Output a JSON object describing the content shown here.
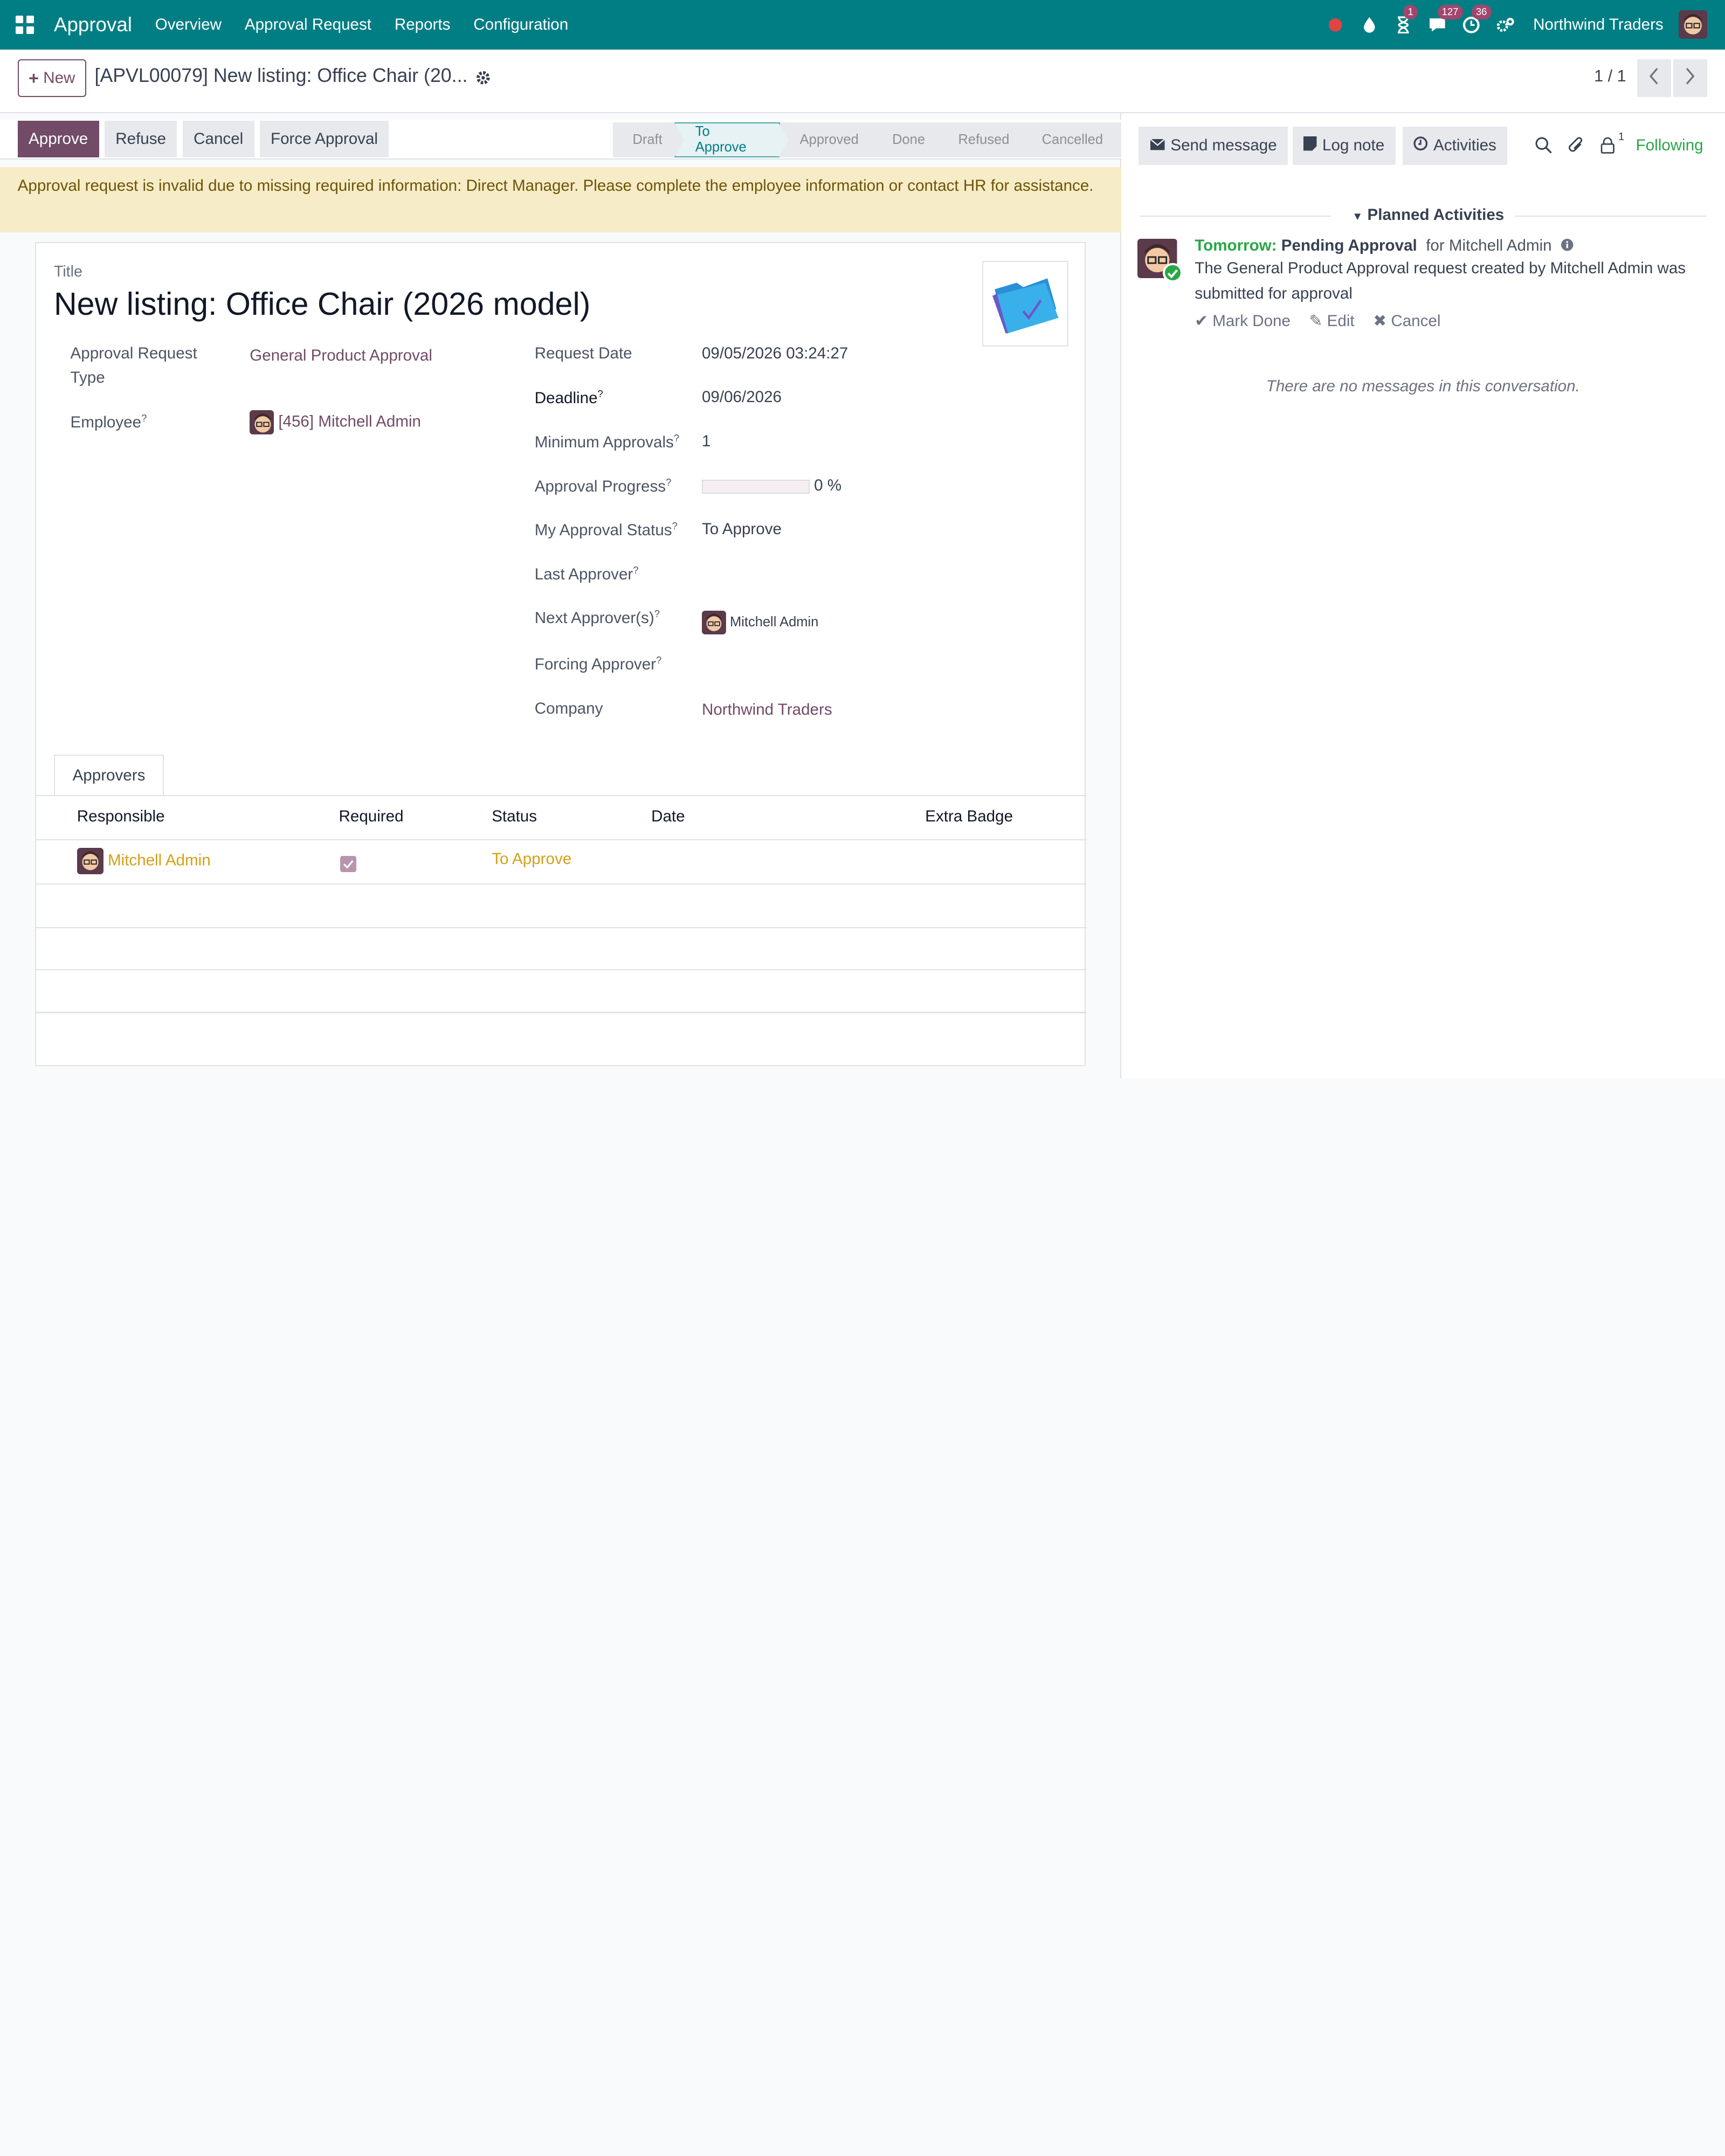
{
  "navbar": {
    "brand": "Approval",
    "menu": [
      "Overview",
      "Approval Request",
      "Reports",
      "Configuration"
    ],
    "badges": {
      "activity": "1",
      "messages": "127",
      "clock": "36"
    },
    "company": "Northwind Traders"
  },
  "control": {
    "new_label": "New",
    "record_title": "[APVL00079] New listing: Office Chair (20...",
    "pager": "1 / 1"
  },
  "statusbar": {
    "buttons": [
      "Approve",
      "Refuse",
      "Cancel",
      "Force Approval"
    ],
    "stages": [
      "Draft",
      "To Approve",
      "Approved",
      "Done",
      "Refused",
      "Cancelled"
    ],
    "active_stage": "To Approve"
  },
  "alert": "Approval request is invalid due to missing required information: Direct Manager. Please complete the employee information or contact HR for assistance.",
  "form": {
    "title_label": "Title",
    "title": "New listing: Office Chair (2026 model)",
    "left": {
      "type_label_1": "Approval Request",
      "type_label_2": "Type",
      "type_value": "General Product Approval",
      "employee_label": "Employee",
      "employee_value": "[456] Mitchell Admin"
    },
    "right": {
      "request_date_label": "Request Date",
      "request_date": "09/05/2026 03:24:27",
      "deadline_label": "Deadline",
      "deadline": "09/06/2026",
      "min_approvals_label": "Minimum Approvals",
      "min_approvals": "1",
      "progress_label": "Approval Progress",
      "progress_value": "0 %",
      "progress_fraction": 0,
      "my_status_label": "My Approval Status",
      "my_status": "To Approve",
      "last_approver_label": "Last Approver",
      "next_approver_label": "Next Approver(s)",
      "next_approver": "Mitchell Admin",
      "forcing_label": "Forcing Approver",
      "company_label": "Company",
      "company": "Northwind Traders"
    },
    "help_mark": "?",
    "tab": "Approvers",
    "table": {
      "headers": [
        "Responsible",
        "Required",
        "Status",
        "Date",
        "Extra Badge"
      ],
      "rows": [
        {
          "responsible": "Mitchell Admin",
          "required": true,
          "status": "To Approve",
          "date": "",
          "extra": ""
        }
      ]
    }
  },
  "chatter": {
    "send_message": "Send message",
    "log_note": "Log note",
    "activities": "Activities",
    "followers_count": "1",
    "following": "Following",
    "planned_title": "Planned Activities",
    "activity": {
      "when": "Tomorrow:",
      "summary": "Pending Approval",
      "for_text": "for Mitchell Admin",
      "text": "The General Product Approval request created by Mitchell Admin was submitted for approval",
      "mark_done": "Mark Done",
      "edit": "Edit",
      "cancel": "Cancel"
    },
    "no_messages": "There are no messages in this conversation."
  },
  "colors": {
    "navbar": "#017e84",
    "primary": "#714b67",
    "alert_bg": "#f6ecc7",
    "success": "#28a745",
    "status_warning": "#d4a017"
  }
}
